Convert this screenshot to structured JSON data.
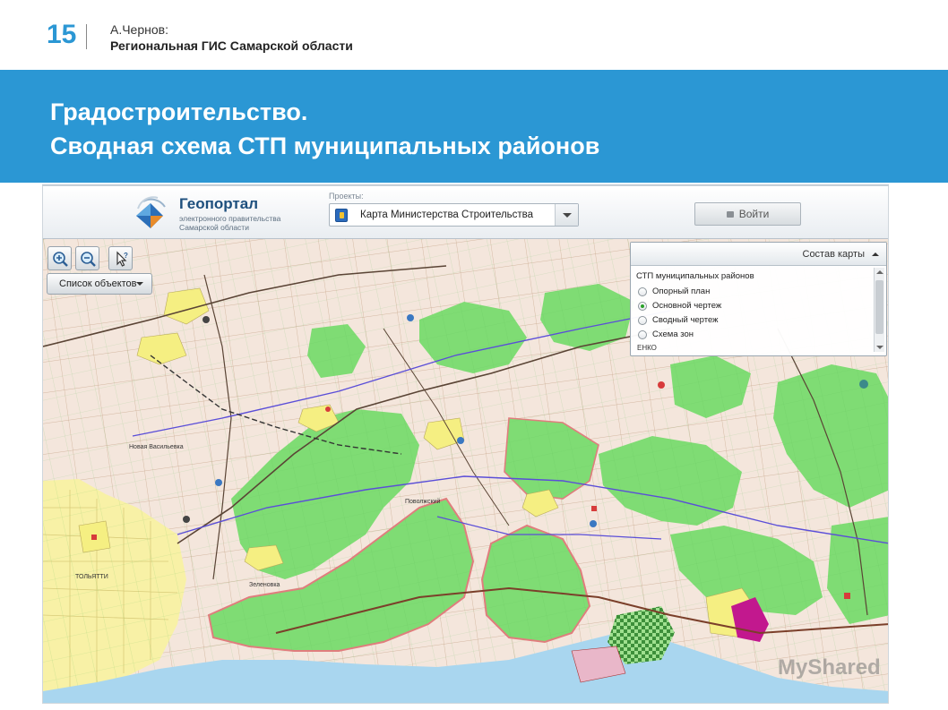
{
  "slide": {
    "number": "15",
    "author": "А.Чернов:",
    "subtitle": "Региональная ГИС Самарской области",
    "title_line1": "Градостроительство.",
    "title_line2": "Сводная схема СТП муниципальных районов"
  },
  "app": {
    "logo_title": "Геопортал",
    "logo_sub1": "электронного правительства",
    "logo_sub2": "Самарской области",
    "projects_label": "Проекты:",
    "project_selected": "Карта Министерства Строительства",
    "login_label": "Войти"
  },
  "toolbar": {
    "zoom_in_icon": "zoom-in-icon",
    "zoom_out_icon": "zoom-out-icon",
    "info_icon": "pointer-info-icon",
    "object_list_label": "Список объектов"
  },
  "layers_panel": {
    "header": "Состав карты",
    "group": "СТП муниципальных районов",
    "options": [
      {
        "label": "Опорный план",
        "selected": false
      },
      {
        "label": "Основной чертеж",
        "selected": true
      },
      {
        "label": "Сводный чертеж",
        "selected": false
      },
      {
        "label": "Схема зон",
        "selected": false
      }
    ],
    "truncated_item": "ЕНКО"
  },
  "map_labels": {
    "tolyatti": "ТОЛЬЯТТИ",
    "new_vasilevka": "Новая Васильевка",
    "zelenovka": "Зеленовка",
    "povolzhsky": "Поволжский"
  },
  "watermark": "MyShared",
  "colors": {
    "accent": "#2b97d4",
    "forest": "#7fdc74",
    "settlement": "#f5ef82",
    "map_bg": "#f4e6dc"
  }
}
